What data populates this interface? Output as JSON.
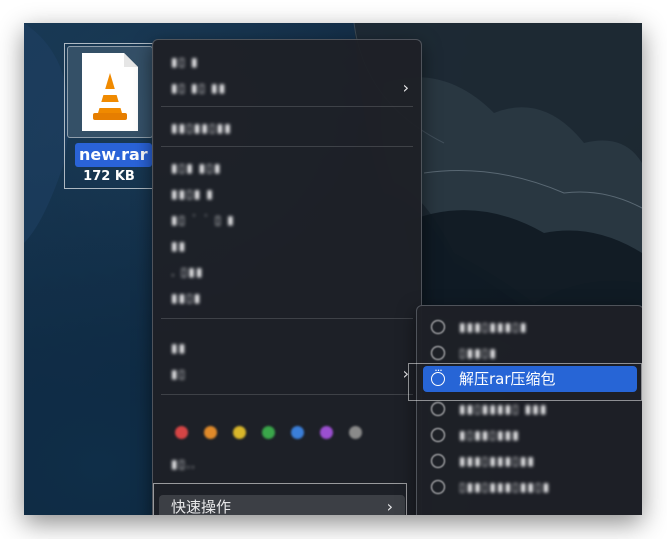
{
  "file": {
    "name": "new.rar",
    "size": "172 KB",
    "icon": "vlc-cone-icon"
  },
  "context_menu": {
    "quick_actions_label": "快速操作",
    "has_submenu_chevron": "›",
    "tag_colors": [
      "#d64545",
      "#e08a2a",
      "#d9b62a",
      "#3aa64a",
      "#3b7fd9",
      "#9b4fd0",
      "#8a8a8a"
    ]
  },
  "submenu": {
    "active_item_label": "解压rar压缩包",
    "active_item_icon": "ellipsis-circle-icon"
  }
}
